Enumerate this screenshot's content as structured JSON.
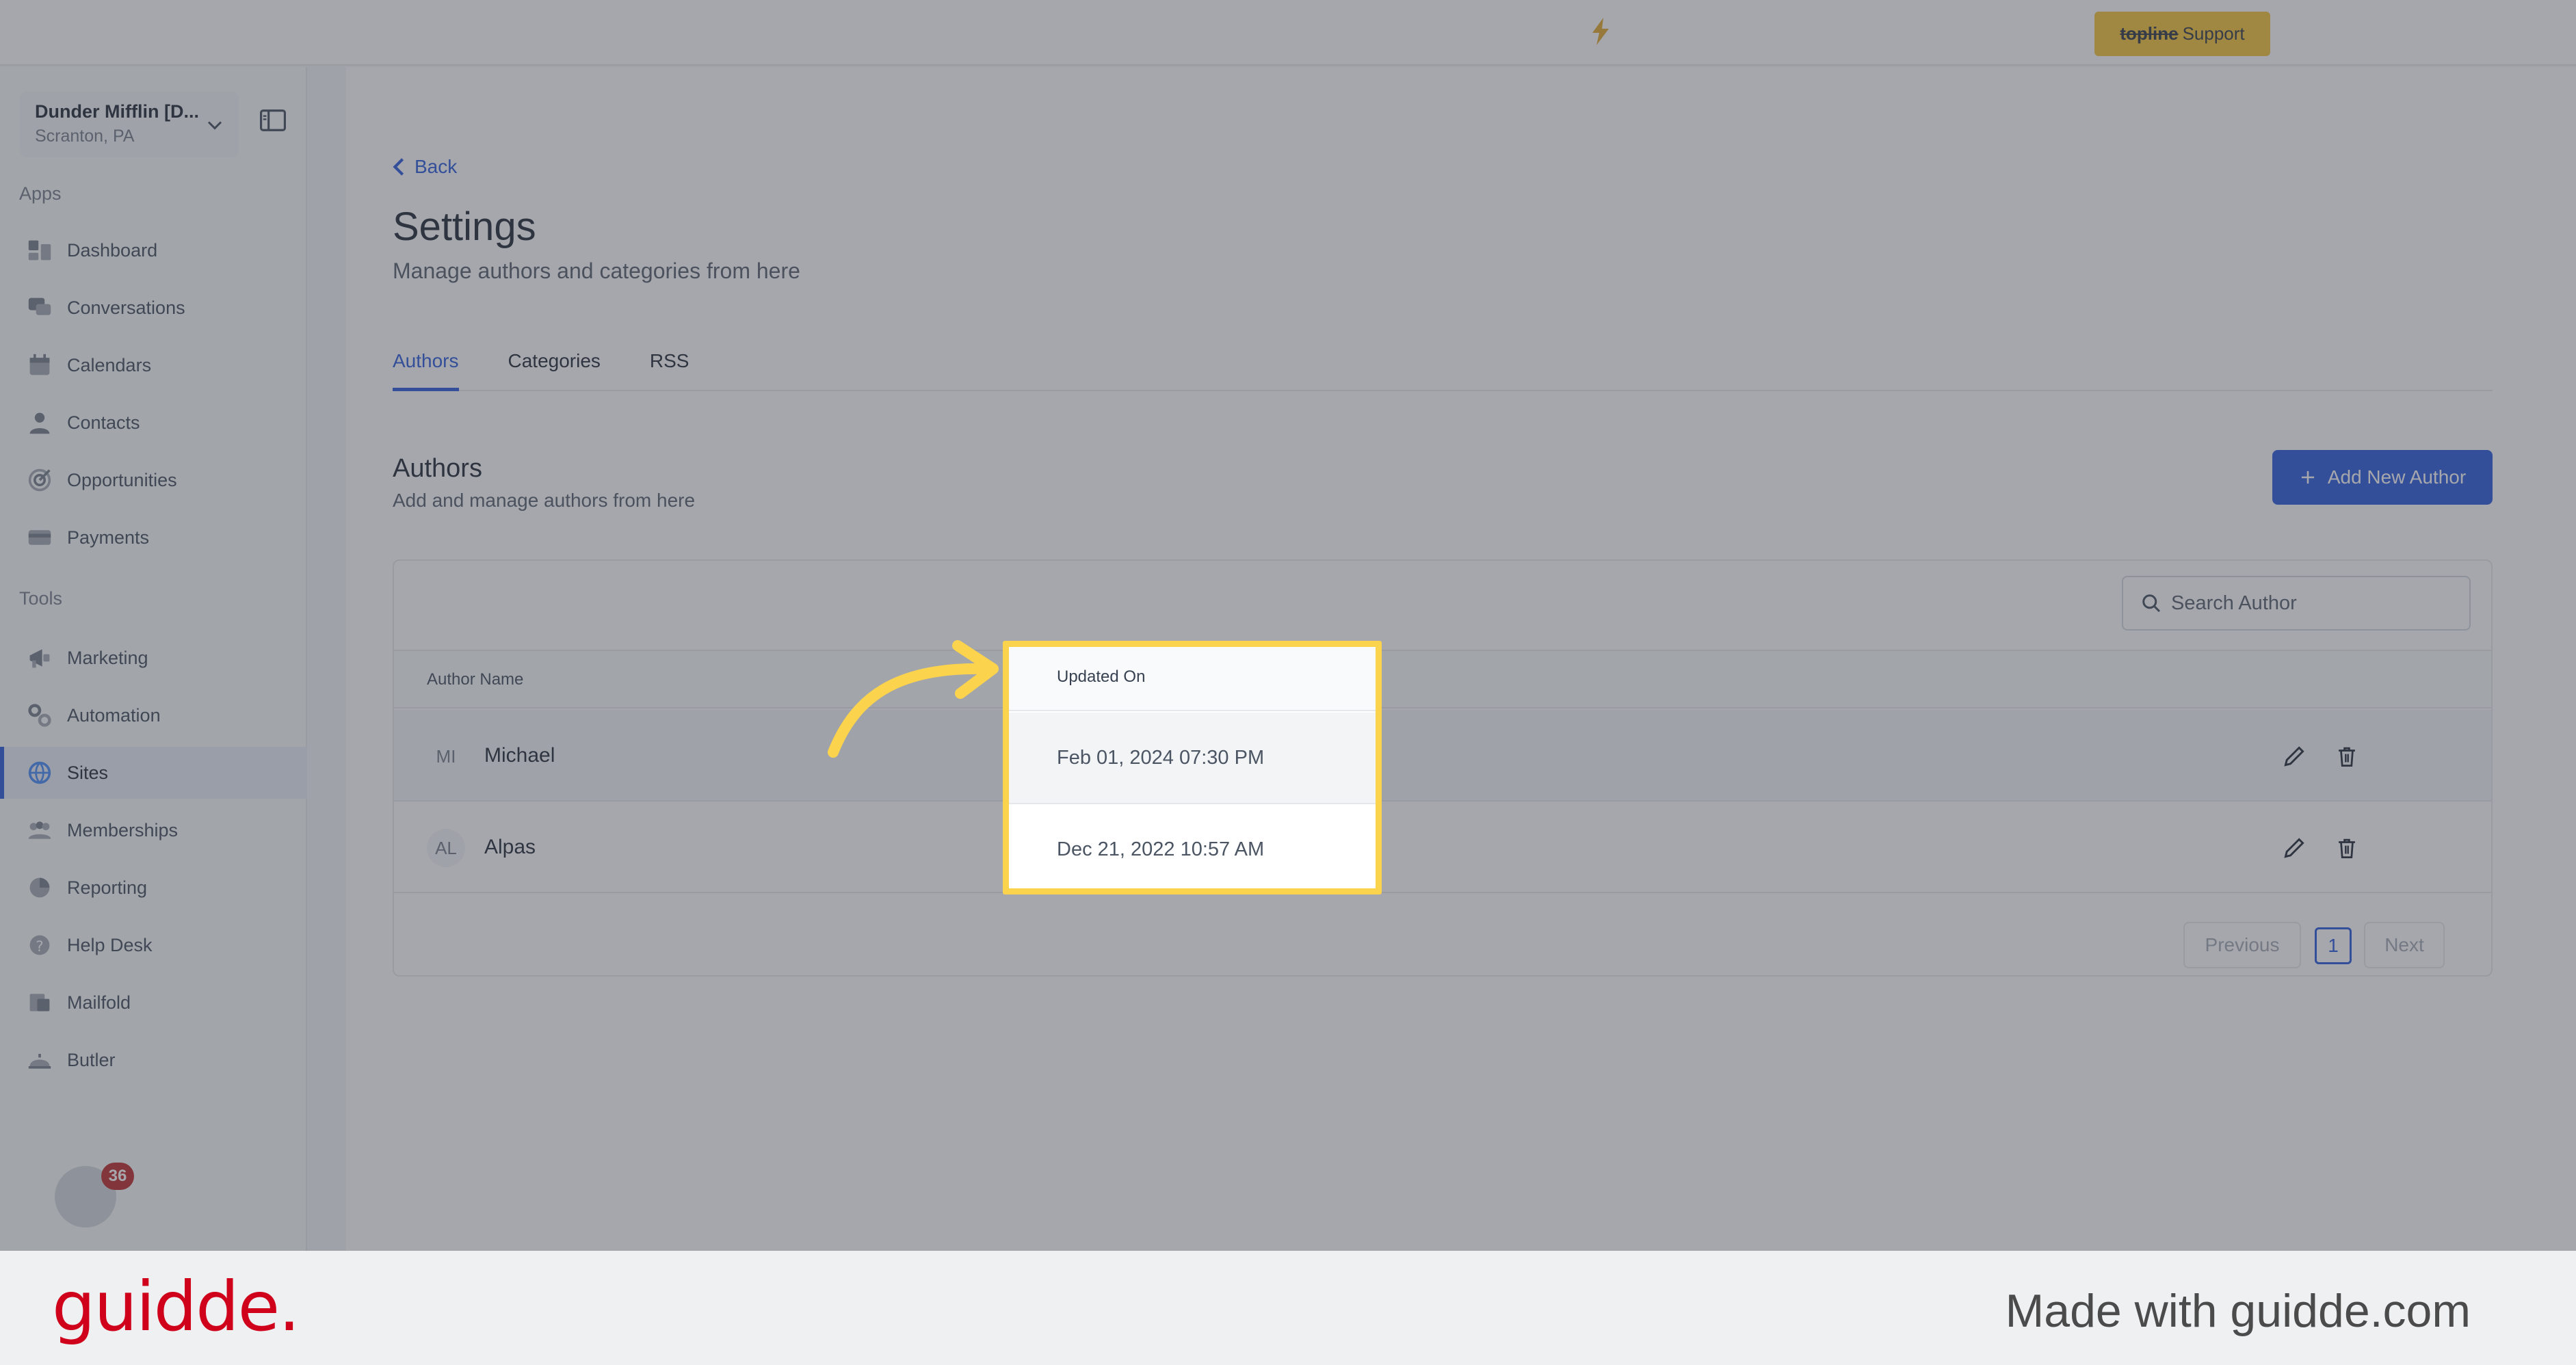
{
  "topbar": {
    "support_brand": "topline",
    "support_label": "Support"
  },
  "sidebar": {
    "account": {
      "name": "Dunder Mifflin [D...",
      "location": "Scranton, PA"
    },
    "apps_label": "Apps",
    "apps": [
      {
        "label": "Dashboard",
        "icon": "dashboard-icon"
      },
      {
        "label": "Conversations",
        "icon": "chat-icon"
      },
      {
        "label": "Calendars",
        "icon": "calendar-icon"
      },
      {
        "label": "Contacts",
        "icon": "person-icon"
      },
      {
        "label": "Opportunities",
        "icon": "target-icon"
      },
      {
        "label": "Payments",
        "icon": "credit-card-icon"
      }
    ],
    "tools_label": "Tools",
    "tools": [
      {
        "label": "Marketing",
        "icon": "megaphone-icon"
      },
      {
        "label": "Automation",
        "icon": "gears-icon"
      },
      {
        "label": "Sites",
        "icon": "globe-icon",
        "active": true
      },
      {
        "label": "Memberships",
        "icon": "users-icon"
      },
      {
        "label": "Reporting",
        "icon": "pie-chart-icon"
      },
      {
        "label": "Help Desk",
        "icon": "help-icon"
      },
      {
        "label": "Mailfold",
        "icon": "mail-icon"
      },
      {
        "label": "Butler",
        "icon": "butler-icon"
      }
    ],
    "notification_count": "36"
  },
  "main": {
    "back_label": "Back",
    "title": "Settings",
    "subtitle": "Manage authors and categories from here",
    "tabs": [
      {
        "label": "Authors",
        "active": true
      },
      {
        "label": "Categories"
      },
      {
        "label": "RSS"
      }
    ],
    "section_title": "Authors",
    "section_subtitle": "Add and manage authors from here",
    "add_button_label": "Add New Author",
    "search_placeholder": "Search Author",
    "columns": {
      "author_name": "Author Name",
      "updated_on": "Updated On"
    },
    "authors": [
      {
        "initials": "MI",
        "name": "Michael",
        "updated_on": "Feb 01, 2024 07:30 PM"
      },
      {
        "initials": "AL",
        "name": "Alpas",
        "updated_on": "Dec 21, 2022 10:57 AM"
      }
    ],
    "pagination": {
      "previous": "Previous",
      "current": "1",
      "next": "Next"
    }
  },
  "footer": {
    "logo": "guidde.",
    "made_with": "Made with guidde.com"
  },
  "colors": {
    "accent": "#1d4ed8",
    "highlight": "#fcd34d",
    "support_button": "#f4be2a",
    "guidde_red": "#d0021b"
  }
}
